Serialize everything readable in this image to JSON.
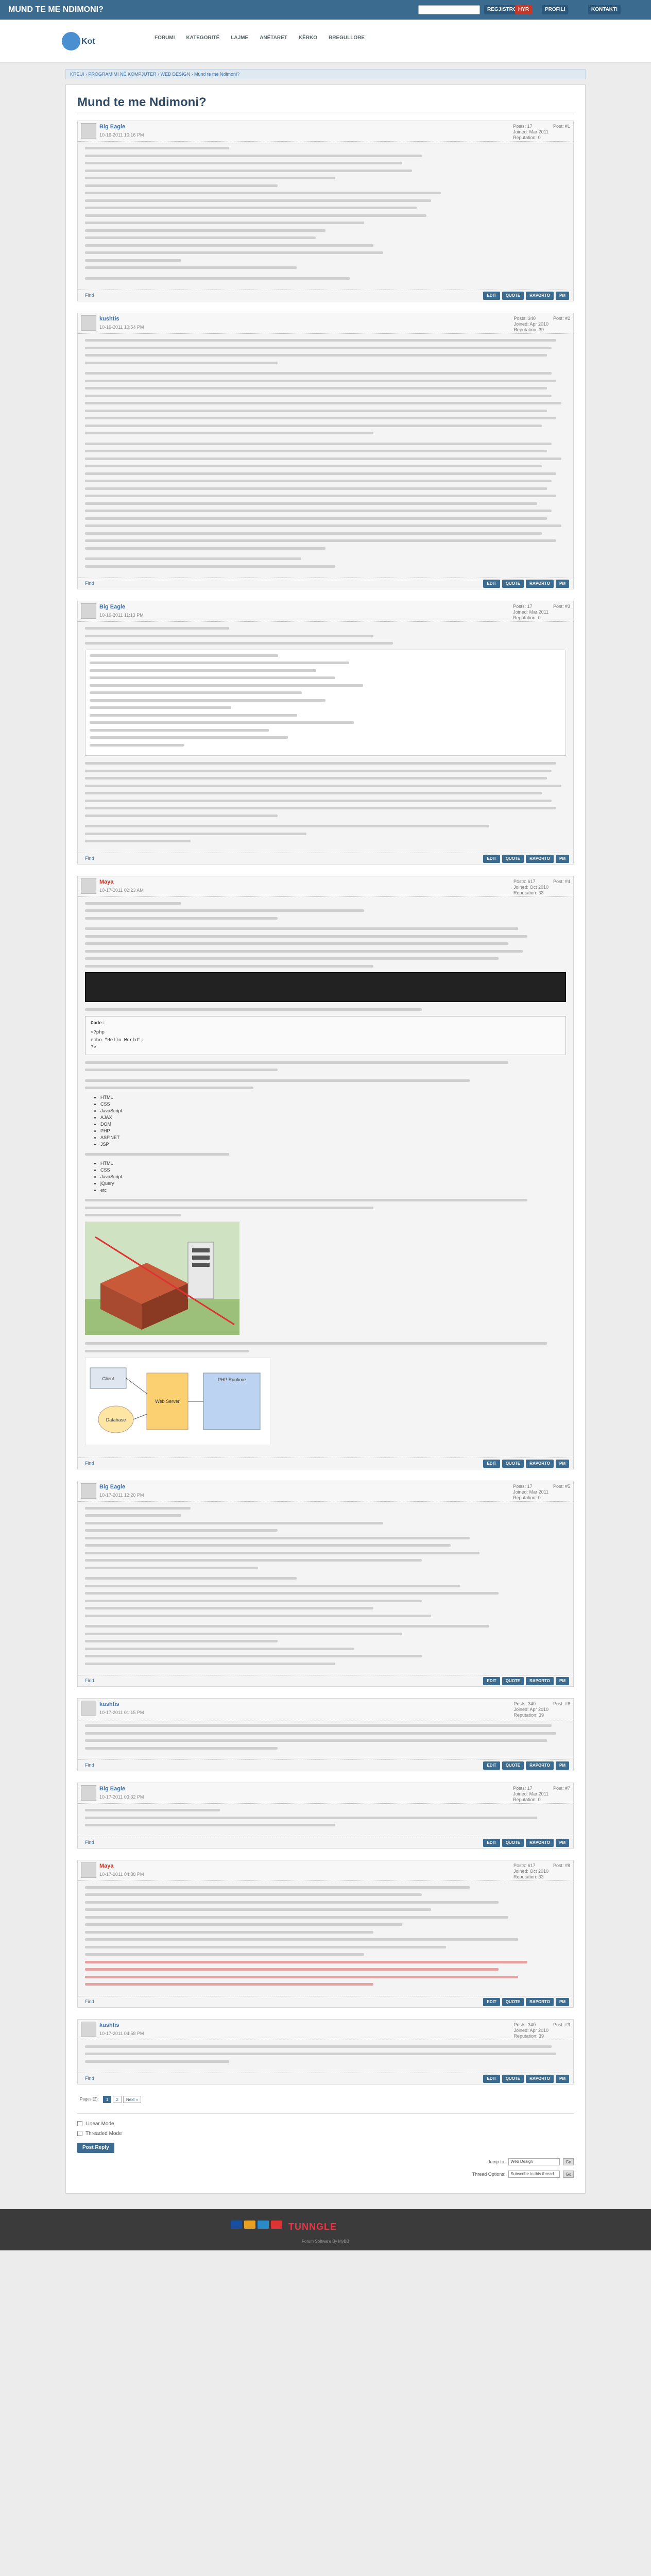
{
  "topbar": {
    "page_title": "MUND TE ME NDIMONI?",
    "search_placeholder": "",
    "buttons": [
      "REGJISTROHU",
      "HYR",
      "PROFILI",
      "KONTAKTI"
    ]
  },
  "header": {
    "logo_text": "Kot",
    "nav": [
      "FORUMI",
      "KATEGORITË",
      "LAJME",
      "ANËTARËT",
      "KËRKO",
      "RREGULLORE"
    ]
  },
  "breadcrumb": "KREUI › PROGRAMIMI NË KOMPJUTER › WEB DESIGN › Mund te me Ndimoni?",
  "thread_title": "Mund te me Ndimoni?",
  "posts": [
    {
      "author": "Big Eagle",
      "date": "10-16-2011 10:16 PM",
      "meta": [
        "Posts: 17",
        "Joined: Mar 2011",
        "Reputation: 0"
      ],
      "num": "Post: #1",
      "mod": false
    },
    {
      "author": "kushtis",
      "date": "10-16-2011 10:54 PM",
      "meta": [
        "Posts: 340",
        "Joined: Apr 2010",
        "Reputation: 39"
      ],
      "num": "Post: #2",
      "mod": false
    },
    {
      "author": "Big Eagle",
      "date": "10-16-2011 11:13 PM",
      "meta": [
        "Posts: 17",
        "Joined: Mar 2011",
        "Reputation: 0"
      ],
      "num": "Post: #3",
      "mod": false
    },
    {
      "author": "Maya",
      "date": "10-17-2011 02:23 AM",
      "meta": [
        "Posts: 617",
        "Joined: Oct 2010",
        "Reputation: 33"
      ],
      "num": "Post: #4",
      "mod": true
    },
    {
      "author": "Big Eagle",
      "date": "10-17-2011 12:20 PM",
      "meta": [
        "Posts: 17",
        "Joined: Mar 2011",
        "Reputation: 0"
      ],
      "num": "Post: #5",
      "mod": false
    },
    {
      "author": "kushtis",
      "date": "10-17-2011 01:15 PM",
      "meta": [
        "Posts: 340",
        "Joined: Apr 2010",
        "Reputation: 39"
      ],
      "num": "Post: #6",
      "mod": false
    },
    {
      "author": "Big Eagle",
      "date": "10-17-2011 03:32 PM",
      "meta": [
        "Posts: 17",
        "Joined: Mar 2011",
        "Reputation: 0"
      ],
      "num": "Post: #7",
      "mod": false
    },
    {
      "author": "Maya",
      "date": "10-17-2011 04:38 PM",
      "meta": [
        "Posts: 617",
        "Joined: Oct 2010",
        "Reputation: 33"
      ],
      "num": "Post: #8",
      "mod": true
    },
    {
      "author": "kushtis",
      "date": "10-17-2011 04:58 PM",
      "meta": [
        "Posts: 340",
        "Joined: Apr 2010",
        "Reputation: 39"
      ],
      "num": "Post: #9",
      "mod": false
    }
  ],
  "post_foot": {
    "find_label": "Find",
    "buttons": [
      "EDIT",
      "QUOTE",
      "RAPORTO",
      "PM"
    ]
  },
  "post4": {
    "code_label": "Code:",
    "code_lines": [
      "<?php",
      "echo \"Hello World\";",
      "?>"
    ],
    "list_a": [
      "HTML",
      "CSS",
      "JavaScript",
      "AJAX",
      "DOM",
      "PHP",
      "ASP.NET",
      "JSP"
    ],
    "list_b": [
      "HTML",
      "CSS",
      "JavaScript",
      "jQuery",
      "etc"
    ],
    "diagram_labels": {
      "client": "Client",
      "web": "Web Server",
      "db": "Database",
      "php": "PHP Runtime"
    }
  },
  "pagination": {
    "label": "Pages (2):",
    "pages": [
      "1",
      "2",
      "Next »"
    ]
  },
  "bottom": {
    "options": [
      "Linear Mode",
      "Threaded Mode"
    ],
    "post_reply": "Post Reply",
    "forum_jump_label": "Jump to:",
    "forum_jump_value": "Web Design",
    "go": "Go",
    "subscribe_label": "Thread Options:",
    "subscribe_value": "Subscribe to this thread",
    "go2": "Go"
  },
  "footer": {
    "brand": "TUNNGLE",
    "text": "Forum Software By MyBB"
  }
}
